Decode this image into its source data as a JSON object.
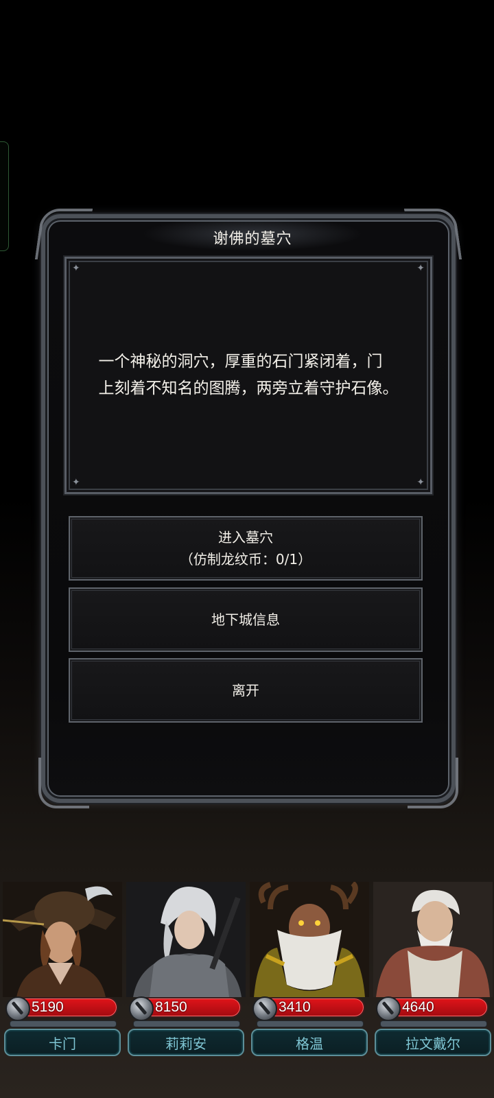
{
  "dialog": {
    "title": "谢佛的墓穴",
    "description_line1": "一个神秘的洞穴，厚重的石门紧闭着，门",
    "description_line2": "上刻着不知名的图腾，两旁立着守护石像。",
    "options": {
      "enter_label": "进入墓穴",
      "enter_cost": "（仿制龙纹币：0/1）",
      "info_label": "地下城信息",
      "leave_label": "离开"
    }
  },
  "heroes": [
    {
      "name": "卡门",
      "power": "5190"
    },
    {
      "name": "莉莉安",
      "power": "8150"
    },
    {
      "name": "格温",
      "power": "3410"
    },
    {
      "name": "拉文戴尔",
      "power": "4640"
    }
  ],
  "colors": {
    "hp_red": "#d4121a",
    "name_teal": "#7fc6d4",
    "frame_silver": "#5d636b"
  }
}
